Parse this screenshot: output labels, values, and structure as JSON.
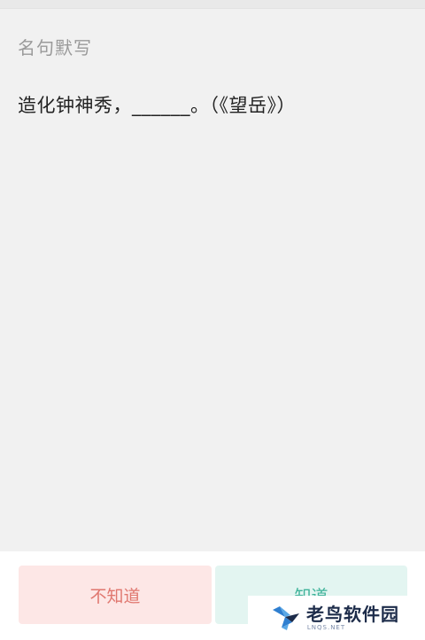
{
  "section": {
    "title": "名句默写"
  },
  "question": {
    "text": "造化钟神秀，______。（《望岳》）"
  },
  "actions": {
    "unknown_label": "不知道",
    "known_label": "知道"
  },
  "watermark": {
    "title": "老鸟软件园",
    "subtitle": "LNQS.NET",
    "icon": "bird-logo-icon"
  },
  "colors": {
    "background": "#f1f1f1",
    "unknown_button_bg": "#fde7e6",
    "unknown_button_text": "#e0776f",
    "known_button_bg": "#e3f5f1",
    "known_button_text": "#3fb39a"
  }
}
